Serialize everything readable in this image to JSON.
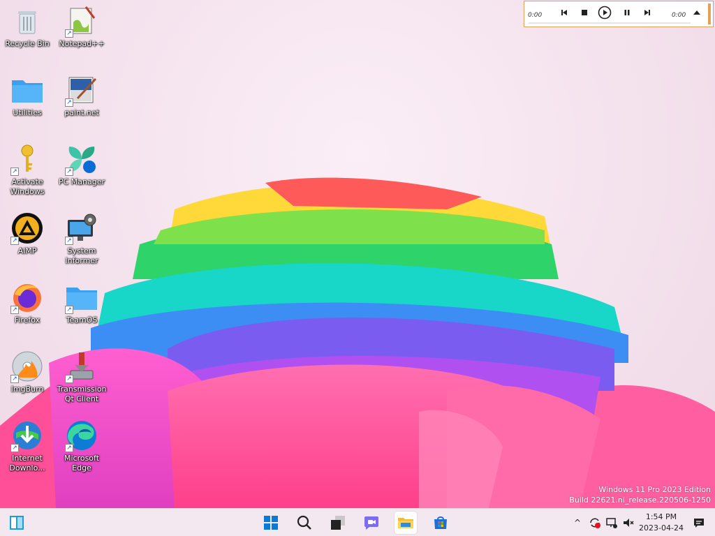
{
  "desktop": {
    "icons": [
      {
        "label": "Recycle Bin",
        "icon": "recycle-bin-icon"
      },
      {
        "label": "Notepad++",
        "icon": "notepad-plus-plus-icon"
      },
      {
        "label": "Utilities",
        "icon": "folder-icon"
      },
      {
        "label": "paint.net",
        "icon": "paint-net-icon"
      },
      {
        "label": "Activate Windows",
        "icon": "key-icon"
      },
      {
        "label": "PC Manager",
        "icon": "pc-manager-icon"
      },
      {
        "label": "AIMP",
        "icon": "aimp-icon"
      },
      {
        "label": "System Informer",
        "icon": "system-informer-icon"
      },
      {
        "label": "Firefox",
        "icon": "firefox-icon"
      },
      {
        "label": "TeamOS",
        "icon": "folder-icon"
      },
      {
        "label": "ImgBurn",
        "icon": "imgburn-icon"
      },
      {
        "label": "Transmission Qt Client",
        "icon": "transmission-icon"
      },
      {
        "label": "Internet Downlo...",
        "icon": "internet-download-manager-icon"
      },
      {
        "label": "Microsoft Edge",
        "icon": "edge-icon"
      }
    ]
  },
  "player": {
    "elapsed": "0:00",
    "total": "0:00"
  },
  "watermark": {
    "line1": "Windows 11 Pro 2023 Edition",
    "line2": "Build 22621.ni_release.220506-1250"
  },
  "taskbar": {
    "items": [
      "widgets-icon",
      "start-icon",
      "search-icon",
      "task-view-icon",
      "chat-icon",
      "file-explorer-icon",
      "store-icon"
    ],
    "tray": {
      "chevron": "^",
      "time": "1:54 PM",
      "date": "2023-04-24"
    }
  },
  "colors": {
    "accent": "#0078d4",
    "player_border": "#e2a156",
    "taskbar_bg": "#f3e8ef"
  }
}
